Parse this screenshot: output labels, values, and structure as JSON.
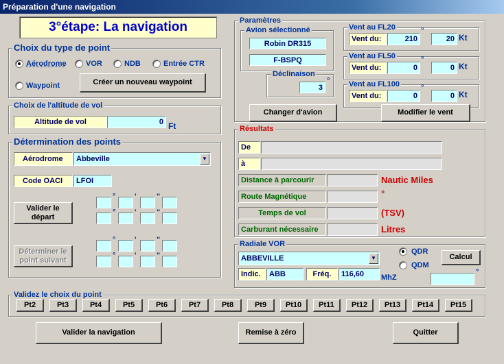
{
  "window": {
    "title": "Préparation d'une navigation"
  },
  "banner": "3°étape: La navigation",
  "type_point": {
    "legend": "Choix du type de point",
    "options": [
      "Aérodrome",
      "VOR",
      "NDB",
      "Entrée CTR",
      "Waypoint"
    ],
    "selected": "Aérodrome",
    "create_waypoint": "Créer un nouveau waypoint"
  },
  "altitude": {
    "legend": "Choix de l'altitude de vol",
    "label": "Altitude de vol",
    "value": "0",
    "unit": "Ft"
  },
  "points": {
    "legend": "Détermination des points",
    "aerodrome_label": "Aérodrome",
    "aerodrome_value": "Abbeville",
    "oaci_label": "Code OACI",
    "oaci_value": "LFOI",
    "validate_departure": "Valider le départ",
    "next_point": "Déterminer le point suivant",
    "deg_symbol": "°",
    "min_symbol": "'",
    "sec_symbol": "\""
  },
  "params": {
    "legend": "Paramètres",
    "avion_legend": "Avion sélectionné",
    "avion_type": "Robin DR315",
    "avion_immat": "F-BSPQ",
    "decl_legend": "Déclinaison",
    "decl_value": "3",
    "change_plane": "Changer d'avion",
    "modify_wind": "Modifier le vent"
  },
  "winds": [
    {
      "legend": "Vent au FL20",
      "label": "Vent du:",
      "dir": "210",
      "speed": "20",
      "unit": "Kt"
    },
    {
      "legend": "Vent au FL50",
      "label": "Vent du:",
      "dir": "0",
      "speed": "0",
      "unit": "Kt"
    },
    {
      "legend": "Vent au FL100",
      "label": "Vent du:",
      "dir": "0",
      "speed": "0",
      "unit": "Kt"
    }
  ],
  "results": {
    "legend": "Résultats",
    "from_label": "De",
    "to_label": "à",
    "distance_label": "Distance à parcourir",
    "distance_unit": "Nautic Miles",
    "route_label": "Route Magnétique",
    "route_unit": "°",
    "time_label": "Temps de vol",
    "time_unit": "(TSV)",
    "fuel_label": "Carburant nécessaire",
    "fuel_unit": "Litres"
  },
  "vor": {
    "legend": "Radiale VOR",
    "station": "ABBEVILLE",
    "qdr": "QDR",
    "qdm": "QDM",
    "selected": "QDR",
    "calc": "Calcul",
    "indic_label": "Indic.",
    "indic_value": "ABB",
    "freq_label": "Fréq.",
    "freq_value": "116,60",
    "freq_unit": "MhZ"
  },
  "validate_points": {
    "legend": "Validez le choix du point",
    "buttons": [
      "Pt2",
      "Pt3",
      "Pt4",
      "Pt5",
      "Pt6",
      "Pt7",
      "Pt8",
      "Pt9",
      "Pt10",
      "Pt11",
      "Pt12",
      "Pt13",
      "Pt14",
      "Pt15"
    ]
  },
  "footer": {
    "validate": "Valider la navigation",
    "reset": "Remise à zéro",
    "quit": "Quitter"
  }
}
